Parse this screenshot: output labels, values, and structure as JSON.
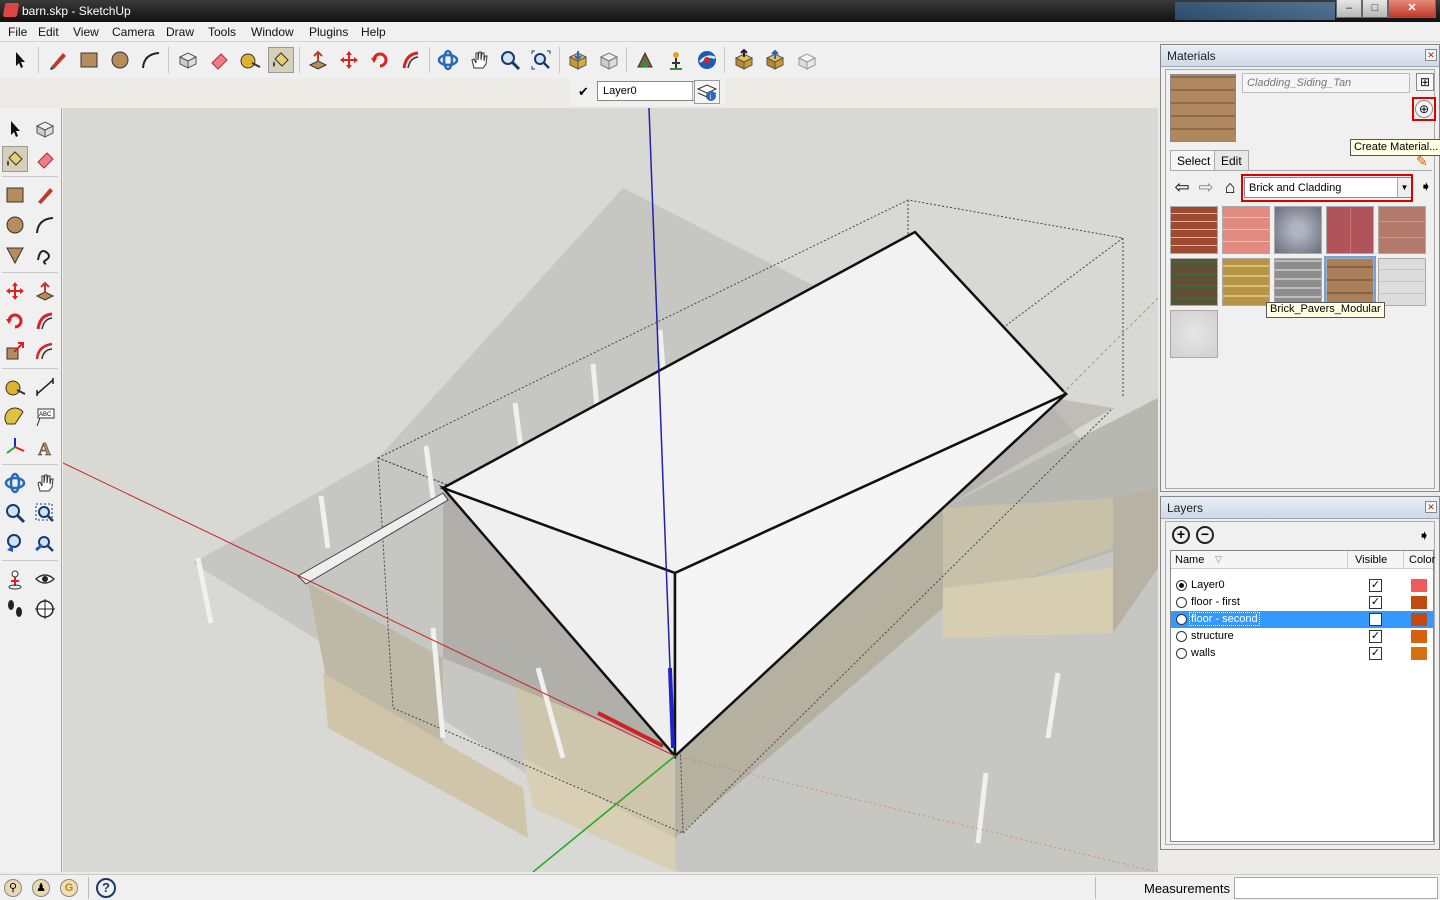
{
  "window": {
    "title": "barn.skp - SketchUp",
    "buttons": [
      "‒",
      "□",
      "✕"
    ]
  },
  "menu": [
    "File",
    "Edit",
    "View",
    "Camera",
    "Draw",
    "Tools",
    "Window",
    "Plugins",
    "Help"
  ],
  "toolbar": {
    "tools": [
      "select-icon",
      "pencil-icon",
      "rectangle-icon",
      "circle-icon",
      "arc-icon",
      "make-component-icon",
      "eraser-icon",
      "tape-measure-icon",
      "paint-bucket-icon",
      "push-pull-icon",
      "move-icon",
      "rotate-icon",
      "follow-me-icon",
      "orbit-icon",
      "pan-icon",
      "zoom-icon",
      "zoom-extents-icon",
      "get-models-icon",
      "share-model-icon",
      "share-component-icon",
      "get-photo-texture-icon",
      "extension-warehouse-icon",
      "send-to-layout-icon",
      "preview-icon",
      "model-info-icon"
    ],
    "active_tool": "paint-bucket-icon"
  },
  "layer_toolbar": {
    "current_layer": "Layer0",
    "checkmark": "✔"
  },
  "left_toolbar": {
    "tools": [
      "select-icon",
      "make-component-icon",
      "paint-bucket-icon",
      "eraser-icon",
      "rectangle-icon",
      "line-icon",
      "circle-icon",
      "arc-icon",
      "polygon-icon",
      "freehand-icon",
      "move-icon",
      "push-pull-icon",
      "rotate-icon",
      "follow-me-icon",
      "scale-icon",
      "offset-icon",
      "tape-measure-icon",
      "dimension-icon",
      "protractor-icon",
      "text-icon",
      "axes-icon",
      "3d-text-icon",
      "orbit-icon",
      "pan-icon",
      "zoom-icon",
      "zoom-window-icon",
      "previous-view-icon",
      "zoom-extents-icon",
      "position-camera-icon",
      "look-around-icon",
      "walk-icon",
      "section-plane-icon"
    ]
  },
  "materials": {
    "panel_title": "Materials",
    "current_material": "Cladding_Siding_Tan",
    "create_tooltip": "Create Material...",
    "tabs": [
      "Select",
      "Edit"
    ],
    "collection": "Brick and Cladding",
    "hover_tooltip": "Brick_Pavers_Modular",
    "swatch_colors": [
      "#9c4a32",
      "#e08a80",
      "#8c909e",
      "#b0545a",
      "#b3796a",
      "#5a5138",
      "#b89448",
      "#8d8d8d",
      "#a9805a",
      "#dcdcdc",
      "#d6d6d6"
    ],
    "selected_swatch": 8,
    "accent_color": "#d00000"
  },
  "layers": {
    "panel_title": "Layers",
    "add_button": "+",
    "remove_button": "−",
    "columns": [
      "Name",
      "Visible",
      "Color"
    ],
    "rows": [
      {
        "name": "Layer0",
        "visible": true,
        "active": true,
        "color": "#f05a5a"
      },
      {
        "name": "floor - first",
        "visible": true,
        "active": false,
        "color": "#c04a10"
      },
      {
        "name": "floor - second",
        "visible": false,
        "active": false,
        "color": "#c04a10",
        "selected": true
      },
      {
        "name": "structure",
        "visible": true,
        "active": false,
        "color": "#d86010"
      },
      {
        "name": "walls",
        "visible": true,
        "active": false,
        "color": "#d87010"
      }
    ]
  },
  "status": {
    "measurements_label": "Measurements",
    "help_icon": "?"
  }
}
